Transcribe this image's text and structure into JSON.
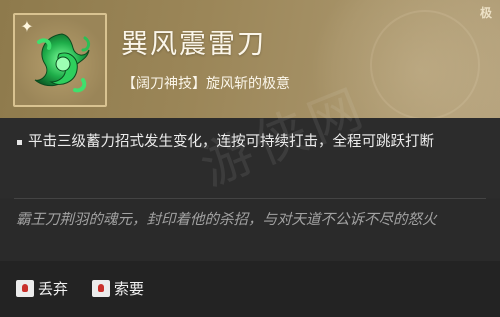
{
  "item": {
    "name": "巽风震雷刀",
    "tag": "【阔刀神技】旋风斩的极意",
    "rarity_mark": "极",
    "icon": "jade-serpent-icon",
    "badge_icon": "four-point-star-icon"
  },
  "effect": {
    "text": "平击三级蓄力招式发生变化，连按可持续打击，全程可跳跃打断"
  },
  "lore": {
    "text": "霸王刀荆羽的魂元，封印着他的杀招，与对天道不公诉不尽的怒火"
  },
  "actions": [
    {
      "label": "丢弃",
      "icon": "mouse-button-icon"
    },
    {
      "label": "索要",
      "icon": "mouse-button-icon"
    }
  ],
  "watermark": "游侠网",
  "colors": {
    "header_gold": "#9b8658",
    "panel_dark": "#2c2c2c",
    "mouse_red": "#c9302b"
  }
}
